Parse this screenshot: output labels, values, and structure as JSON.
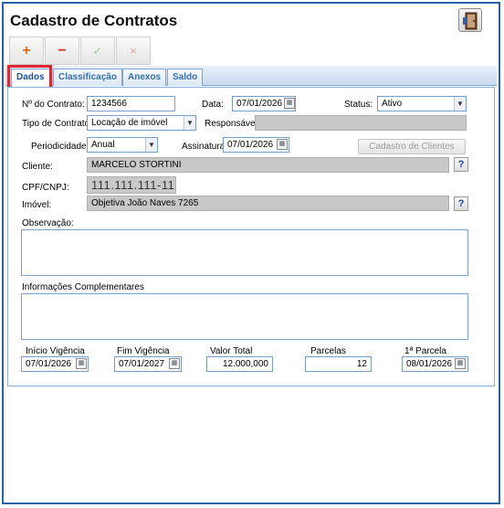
{
  "window": {
    "title": "Cadastro de Contratos",
    "exit_icon": "exit-door-icon"
  },
  "toolbar": {
    "add_symbol": "+",
    "remove_symbol": "−",
    "confirm_symbol": "✓",
    "cancel_symbol": "×"
  },
  "tabs": [
    "Dados",
    "Classificação",
    "Anexos",
    "Saldo"
  ],
  "form": {
    "numero_label": "Nº do Contrato:",
    "numero_value": "1234566",
    "data_label": "Data:",
    "data_value": "07/01/2026",
    "status_label": "Status:",
    "status_value": "Ativo",
    "tipo_label": "Tipo de Contrato:",
    "tipo_value": "Locação de imóvel",
    "responsavel_label": "Responsável:",
    "responsavel_value": "",
    "periodicidade_label": "Periodicidade:",
    "periodicidade_value": "Anual",
    "assinatura_label": "Assinatura:",
    "assinatura_value": "07/01/2026",
    "cadastro_clientes_label": "Cadastro de Clientes",
    "cliente_label": "Cliente:",
    "cliente_value": "MARCELO STORTINI",
    "cpf_label": "CPF/CNPJ:",
    "cpf_value": "111.111.111-11",
    "imovel_label": "Imóvel:",
    "imovel_value": "Objetiva João Naves 7265",
    "help_symbol": "?",
    "observacao_label": "Observação:",
    "observacao_value": "",
    "info_label": "Informações Complementares",
    "info_value": "",
    "inicio_label": "Início Vigência",
    "inicio_value": "07/01/2026",
    "fim_label": "Fim Vigência",
    "fim_value": "07/01/2027",
    "valor_label": "Valor Total",
    "valor_value": "12.000,000",
    "parcelas_label": "Parcelas",
    "parcelas_value": "12",
    "primeira_label": "1ª Parcela",
    "primeira_value": "08/01/2026"
  }
}
